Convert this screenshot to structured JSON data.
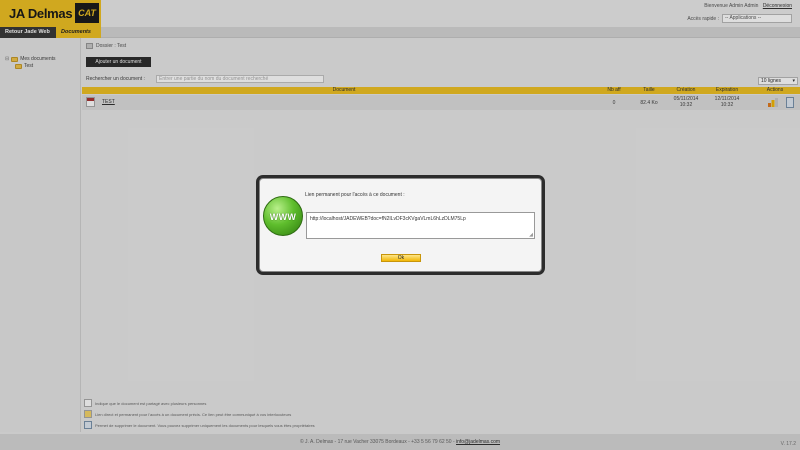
{
  "header": {
    "logo_text": "JA Delmas",
    "logo_cat": "CAT",
    "welcome": "Bienvenue Admin Admin",
    "logout": "Déconnexion",
    "quick_label": "Accès rapide :",
    "quick_select": "-- Applications --",
    "brand_color": "#efc224"
  },
  "nav": {
    "tabs": [
      {
        "label": "Retour Jade Web"
      },
      {
        "label": "Documents"
      }
    ]
  },
  "sidebar": {
    "items": [
      {
        "label": "Mes documents",
        "icon": "folder-icon"
      },
      {
        "label": "Test",
        "icon": "folder-icon"
      }
    ]
  },
  "main": {
    "breadcrumb": "Dossier : Test",
    "add_button": "Ajouter un document",
    "search": {
      "label": "Rechercher un document :",
      "placeholder": "Entrer une partie du nom du document recherché"
    },
    "lines_select": "10 lignes",
    "table": {
      "headers": [
        "Document",
        "Nb aff",
        "Taille",
        "Création",
        "Expiration",
        "Actions"
      ],
      "rows": [
        {
          "name": "TEST",
          "nb_aff": "0",
          "size": "82.4 Ko",
          "created": "05/11/2014",
          "created_time": "10:32",
          "expires": "12/11/2014",
          "expires_time": "10:32"
        }
      ]
    },
    "legend": [
      {
        "text": "Indique que le document est partagé avec plusieurs personnes"
      },
      {
        "text": "Lien direct et permanent pour l'accès à un document précis. Ce lien peut être communiqué à vos interlocuteurs"
      },
      {
        "text": "Permet de supprimer le document. Vous pouvez supprimer uniquement les documents pour lesquels vous êtes propriétaires"
      }
    ]
  },
  "footer": {
    "text": "© J. A. Delmas - 17 rue Vacher 33075 Bordeaux - +33 5 56 79 62 50 -",
    "email": "info@jadelmas.com",
    "version": "V. 17.2"
  },
  "modal": {
    "label": "Lien permanent pour l'accès à ce document :",
    "link": "http://localhost/JADEWEB?doc=fN2ILvDF3cKVgaVLmL6hLzDLM75Lp",
    "ok": "Ok",
    "icon_text": "WWW"
  }
}
